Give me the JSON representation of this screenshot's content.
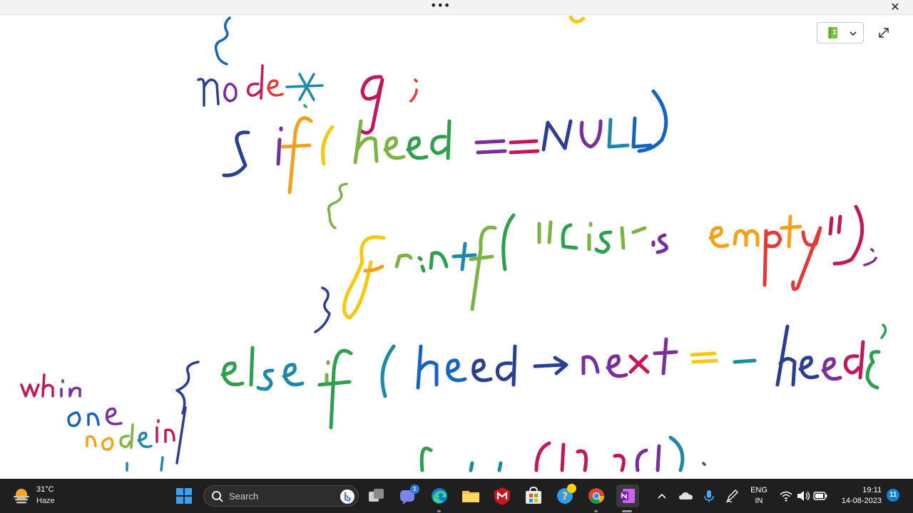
{
  "topbar": {
    "more_label": "•••",
    "close_label": "✕"
  },
  "notebook_picker": {
    "icon": "notebook-icon",
    "accent": "#7dc242"
  },
  "ink_colors": [
    "#2c3e8f",
    "#7a2e99",
    "#c2185b",
    "#e53935",
    "#f4a01b",
    "#f6c90e",
    "#7cb342",
    "#2e9e4f",
    "#1e88a8",
    "#1565c0"
  ],
  "handwriting": {
    "line_1": "{",
    "line_2": "node* q;",
    "line_3": "{ if(head==NULL)",
    "line_4": "{",
    "line_5": "printf(\"list is empty\");",
    "line_6": "}",
    "line_7": "else if(head->next==head){",
    "line_8": "free(head);",
    "side_note": "when one node in"
  },
  "taskbar": {
    "weather": {
      "temp": "31°C",
      "condition": "Haze",
      "icon": "sun-haze-icon"
    },
    "search_placeholder": "Search",
    "apps": [
      {
        "name": "start-icon"
      },
      {
        "name": "task-view-icon"
      },
      {
        "name": "teams-chat-icon",
        "badge": "1"
      },
      {
        "name": "edge-icon"
      },
      {
        "name": "file-explorer-icon"
      },
      {
        "name": "mcafee-icon"
      },
      {
        "name": "microsoft-store-icon"
      },
      {
        "name": "tips-icon"
      },
      {
        "name": "chrome-icon"
      },
      {
        "name": "onenote-icon"
      }
    ],
    "tray": {
      "language_line1": "ENG",
      "language_line2": "IN",
      "time": "19:11",
      "date": "14-08-2023",
      "notifications": "11"
    }
  }
}
